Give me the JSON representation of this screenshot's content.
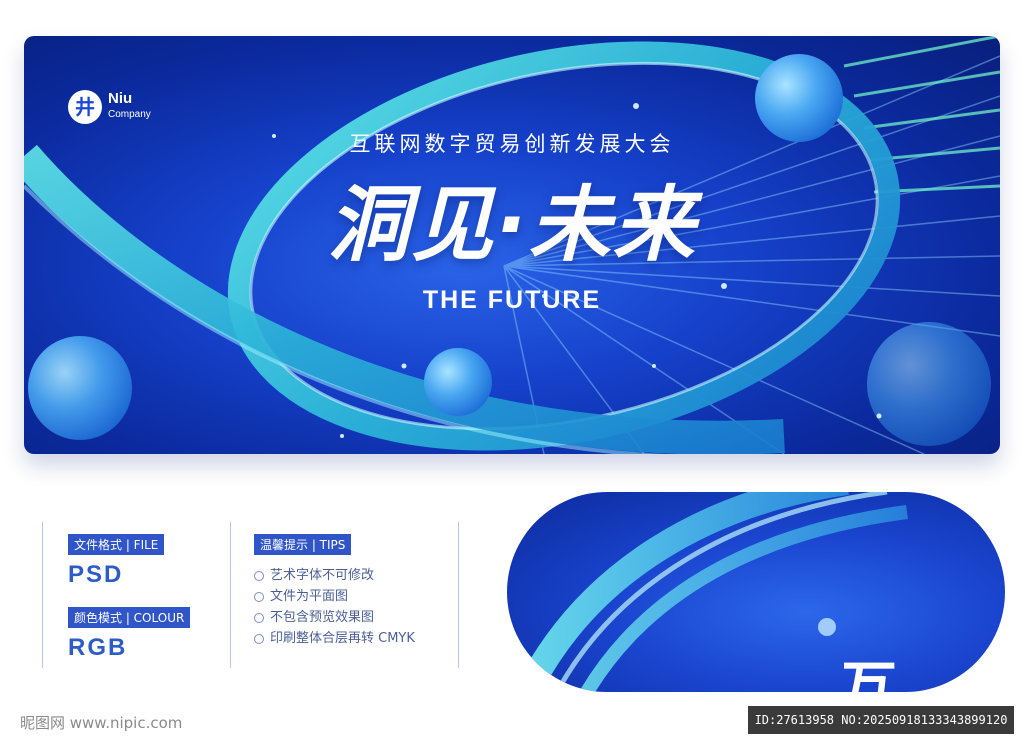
{
  "banner": {
    "logo": {
      "mark": "井",
      "name": "Niu",
      "sub": "Company"
    },
    "subtitle": "互联网数字贸易创新发展大会",
    "headline": "洞见·未来",
    "english_title": "THE FUTURE",
    "colors": {
      "deep": "#0b2a9e",
      "mid": "#1540c9",
      "ring": "#35d0d6",
      "sphere": "#4aa8f5"
    }
  },
  "info": {
    "file_tag": "文件格式 | FILE",
    "file_value": "PSD",
    "colour_tag": "颜色模式 | COLOUR",
    "colour_value": "RGB",
    "tips_tag": "温馨提示 | TIPS",
    "tips": [
      "艺术字体不可修改",
      "文件为平面图",
      "不包含预览效果图",
      "印刷整体合层再转 CMYK"
    ]
  },
  "detail_preview": {
    "text": "互"
  },
  "footer": {
    "left_text": "昵图网 www.nipic.com",
    "right_text": "ID:27613958 NO:20250918133343899120"
  }
}
